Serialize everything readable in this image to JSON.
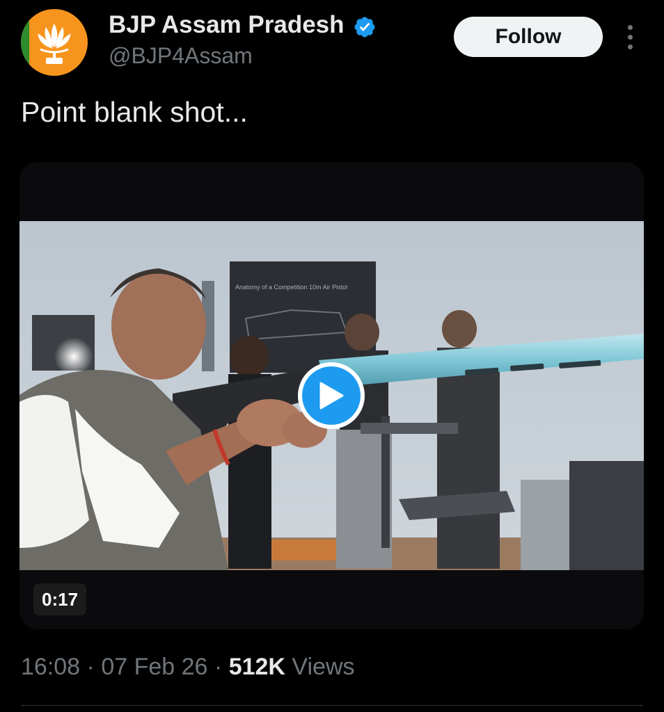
{
  "author": {
    "name": "BJP Assam Pradesh",
    "handle": "@BJP4Assam",
    "verified_icon": "verified-badge-icon",
    "avatar_icon": "lotus-logo-icon",
    "avatar_color": "#f7941d"
  },
  "follow_button": {
    "label": "Follow"
  },
  "more_button": {
    "icon": "more-vertical-icon"
  },
  "tweet": {
    "text": "Point blank shot..."
  },
  "media": {
    "type": "video",
    "duration": "0:17",
    "play_icon": "play-icon",
    "poster_sign_text": "Anatomy of a Competition 10m Air Pistol"
  },
  "meta": {
    "time": "16:08",
    "separator": "·",
    "date": "07 Feb 26",
    "views_count": "512K",
    "views_label": "Views"
  },
  "colors": {
    "background": "#000000",
    "text_primary": "#e7e9ea",
    "text_secondary": "#71767b",
    "accent": "#1d9bf0",
    "follow_bg": "#eff3f4"
  }
}
